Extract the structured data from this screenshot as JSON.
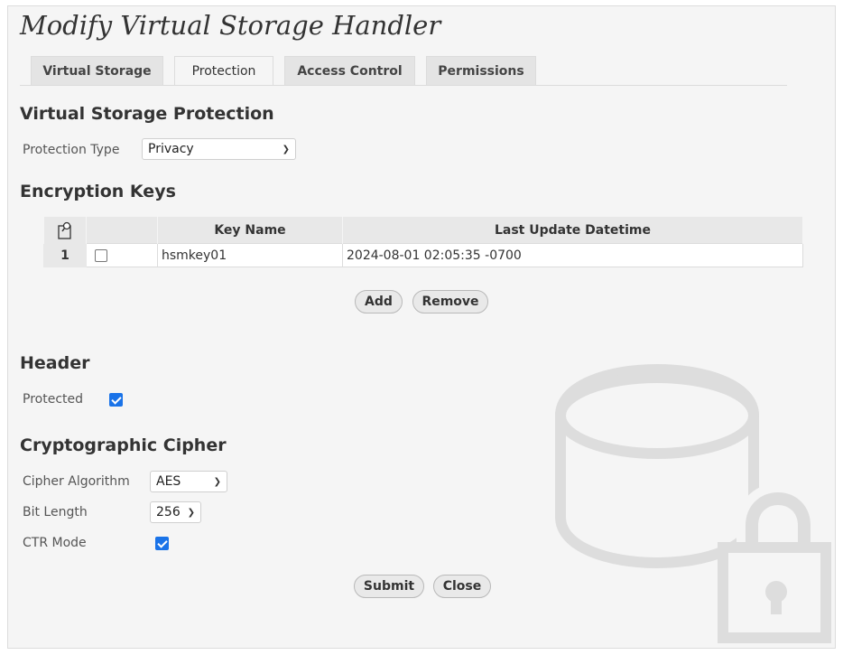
{
  "page": {
    "title": "Modify Virtual Storage Handler"
  },
  "tabs": [
    {
      "label": "Virtual Storage"
    },
    {
      "label": "Protection"
    },
    {
      "label": "Access Control"
    },
    {
      "label": "Permissions"
    }
  ],
  "protection": {
    "heading": "Virtual Storage Protection",
    "type_label": "Protection Type",
    "type_value": "Privacy"
  },
  "keys": {
    "heading": "Encryption Keys",
    "columns": {
      "name": "Key Name",
      "updated": "Last Update Datetime"
    },
    "rows": [
      {
        "num": "1",
        "name": "hsmkey01",
        "updated": "2024-08-01 02:05:35 -0700",
        "selected": false
      }
    ],
    "add_label": "Add",
    "remove_label": "Remove"
  },
  "header": {
    "heading": "Header",
    "protected_label": "Protected",
    "protected_checked": true
  },
  "cipher": {
    "heading": "Cryptographic Cipher",
    "algorithm_label": "Cipher Algorithm",
    "algorithm_value": "AES",
    "bitlength_label": "Bit Length",
    "bitlength_value": "256",
    "ctr_label": "CTR Mode",
    "ctr_checked": true
  },
  "actions": {
    "submit_label": "Submit",
    "close_label": "Close"
  },
  "colors": {
    "accent": "#1a73e8",
    "panel_bg": "#f5f5f5",
    "watermark": "#dddddd"
  }
}
